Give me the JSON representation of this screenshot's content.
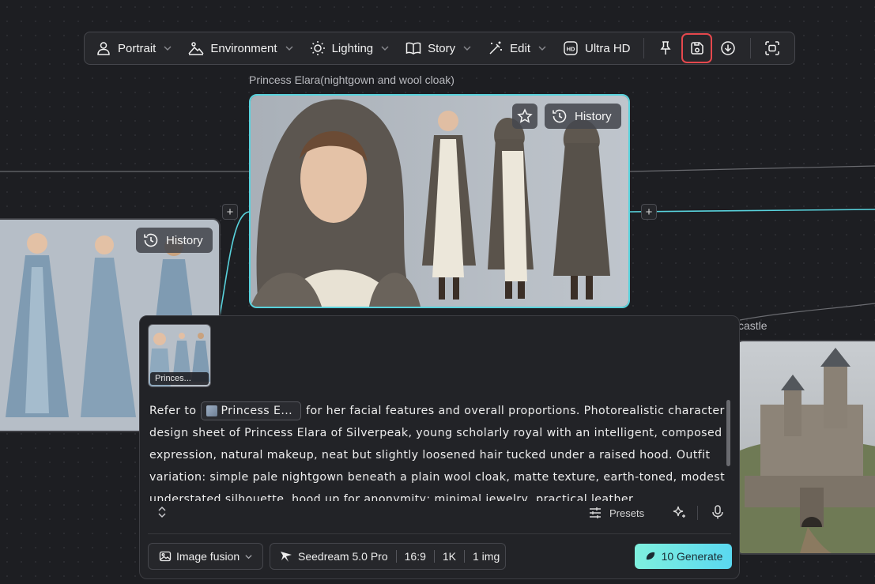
{
  "toolbar": {
    "items": [
      {
        "label": "Portrait",
        "icon": "person-icon"
      },
      {
        "label": "Environment",
        "icon": "landscape-icon"
      },
      {
        "label": "Lighting",
        "icon": "sun-icon"
      },
      {
        "label": "Story",
        "icon": "book-icon"
      },
      {
        "label": "Edit",
        "icon": "magic-wand-icon"
      },
      {
        "label": "Ultra HD",
        "icon": "hd-icon"
      }
    ],
    "actions": [
      "pin-icon",
      "save-to-library-icon",
      "download-icon",
      "screenshot-icon"
    ],
    "highlight_color": "#e5484d"
  },
  "canvas": {
    "edge_color": "#58d2dc",
    "nodes": {
      "main": {
        "title": "Princess Elara(nightgown and wool cloak)",
        "history_label": "History",
        "border_color": "#58d2dc"
      },
      "left": {
        "history_label": "History"
      },
      "right": {
        "title_partial": "castle"
      }
    }
  },
  "panel": {
    "thumbnail_label": "Princes...",
    "prompt_before_chip": "Refer to",
    "chip_label": "Princess E...",
    "prompt_after_chip": "for her facial features and overall proportions. Photorealistic character design sheet of Princess Elara of Silverpeak, young scholarly royal with an intelligent, composed expression, natural makeup, neat but slightly loosened hair tucked under a raised hood. Outfit variation: simple pale nightgown beneath a plain wool cloak, matte texture, earth-toned, modest understated silhouette, hood up for anonymity; minimal jewelry, practical leather",
    "presets_label": "Presets",
    "mode_label": "Image fusion",
    "model_label": "Seedream 5.0 Pro",
    "aspect_ratio": "16:9",
    "resolution": "1K",
    "count": "1 img",
    "generate_label": "10 Generate",
    "generate_gradient": [
      "#7ff0de",
      "#5ad8f0"
    ]
  }
}
